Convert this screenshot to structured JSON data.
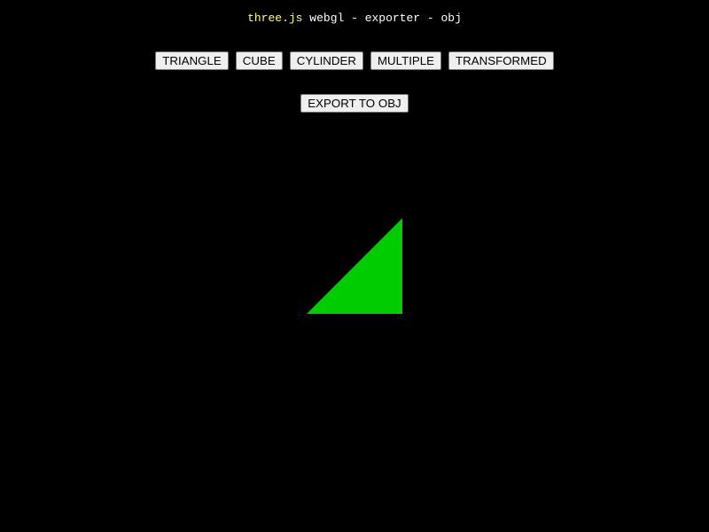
{
  "info": {
    "link_text": "three.js",
    "title_rest": " webgl - exporter - obj"
  },
  "shape_buttons": [
    {
      "label": "TRIANGLE"
    },
    {
      "label": "CUBE"
    },
    {
      "label": "CYLINDER"
    },
    {
      "label": "MULTIPLE"
    },
    {
      "label": "TRANSFORMED"
    }
  ],
  "export_button": {
    "label": "EXPORT TO OBJ"
  },
  "scene": {
    "active_shape": "triangle",
    "mesh_color": "#00cc00",
    "background": "#000000"
  }
}
